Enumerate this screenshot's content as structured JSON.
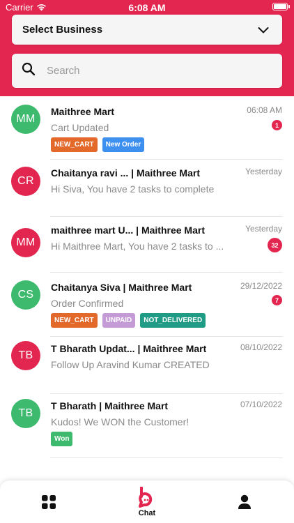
{
  "status_bar": {
    "carrier": "Carrier",
    "time": "6:08 AM"
  },
  "header": {
    "background_color": "#e3264f",
    "select_business_label": "Select Business",
    "search_placeholder": "Search"
  },
  "chats": [
    {
      "initials": "MM",
      "avatar_color": "#3dba6d",
      "title": "Maithree Mart",
      "preview": "Cart Updated",
      "time": "06:08 AM",
      "unread": "1",
      "tags": [
        {
          "label": "NEW_CART",
          "color": "#e3692b"
        },
        {
          "label": "New Order",
          "color": "#3d8ff0"
        }
      ]
    },
    {
      "initials": "CR",
      "avatar_color": "#e3264f",
      "title": "Chaitanya ravi ... |  Maithree Mart",
      "preview": "Hi Siva, You have 2 tasks to complete",
      "time": "Yesterday",
      "unread": "",
      "tags": []
    },
    {
      "initials": "MM",
      "avatar_color": "#e3264f",
      "title": "maithree mart U... |  Maithree Mart",
      "preview": "Hi Maithree Mart, You have 2 tasks to ...",
      "time": "Yesterday",
      "unread": "32",
      "tags": []
    },
    {
      "initials": "CS",
      "avatar_color": "#3dba6d",
      "title": "Chaitanya Siva  |  Maithree Mart",
      "preview": "Order Confirmed",
      "time": "29/12/2022",
      "unread": "7",
      "tags": [
        {
          "label": "NEW_CART",
          "color": "#e3692b"
        },
        {
          "label": "UNPAID",
          "color": "#c49bd6"
        },
        {
          "label": "NOT_DELIVERED",
          "color": "#1f9b86"
        }
      ]
    },
    {
      "initials": "TB",
      "avatar_color": "#e3264f",
      "title": "T Bharath Updat... |  Maithree Mart",
      "preview": "Follow Up Aravind Kumar CREATED",
      "time": "08/10/2022",
      "unread": "",
      "tags": []
    },
    {
      "initials": "TB",
      "avatar_color": "#3dba6d",
      "title": "T Bharath  |  Maithree Mart",
      "preview": "Kudos! We WON the Customer!",
      "time": "07/10/2022",
      "unread": "",
      "tags": [
        {
          "label": "Won",
          "color": "#3dba6d"
        }
      ]
    }
  ],
  "bottom_nav": {
    "items": [
      {
        "icon": "grid-icon",
        "label": ""
      },
      {
        "icon": "chat-icon",
        "label": "Chat",
        "active_color": "#e3264f"
      },
      {
        "icon": "user-icon",
        "label": ""
      }
    ]
  }
}
